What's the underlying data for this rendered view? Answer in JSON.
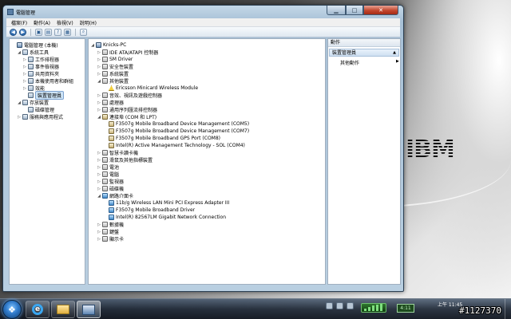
{
  "window": {
    "title": "電腦管理"
  },
  "menu": [
    "檔案(F)",
    "動作(A)",
    "檢視(V)",
    "說明(H)"
  ],
  "left_tree": [
    {
      "label": "電腦管理 (本機)",
      "level": 0,
      "exp": "",
      "icon": "comp"
    },
    {
      "label": "系統工具",
      "level": 1,
      "exp": "◢",
      "icon": "tool"
    },
    {
      "label": "工作排程器",
      "level": 2,
      "exp": "▷",
      "icon": "tool"
    },
    {
      "label": "事件檢視器",
      "level": 2,
      "exp": "▷",
      "icon": "tool"
    },
    {
      "label": "共用資料夾",
      "level": 2,
      "exp": "▷",
      "icon": "tool"
    },
    {
      "label": "本機使用者和群組",
      "level": 2,
      "exp": "▷",
      "icon": "tool"
    },
    {
      "label": "效能",
      "level": 2,
      "exp": "▷",
      "icon": "tool"
    },
    {
      "label": "裝置管理員",
      "level": 2,
      "exp": "",
      "icon": "tool",
      "selected": true
    },
    {
      "label": "存放裝置",
      "level": 1,
      "exp": "◢",
      "icon": "tool"
    },
    {
      "label": "磁碟管理",
      "level": 2,
      "exp": "",
      "icon": "tool"
    },
    {
      "label": "服務與應用程式",
      "level": 1,
      "exp": "▷",
      "icon": "tool"
    }
  ],
  "device_tree": [
    {
      "label": "Knicks-PC",
      "level": 0,
      "exp": "◢",
      "icon": "comp"
    },
    {
      "label": "IDE ATA/ATAPI 控制器",
      "level": 1,
      "exp": "▷",
      "icon": "dev"
    },
    {
      "label": "SM Driver",
      "level": 1,
      "exp": "▷",
      "icon": "dev"
    },
    {
      "label": "安全性裝置",
      "level": 1,
      "exp": "▷",
      "icon": "dev"
    },
    {
      "label": "系統裝置",
      "level": 1,
      "exp": "▷",
      "icon": "dev"
    },
    {
      "label": "其他裝置",
      "level": 1,
      "exp": "◢",
      "icon": "dev"
    },
    {
      "label": "Ericsson Minicard Wireless Module",
      "level": 2,
      "exp": "",
      "icon": "warn"
    },
    {
      "label": "音效、視訊及遊戲控制器",
      "level": 1,
      "exp": "▷",
      "icon": "dev"
    },
    {
      "label": "處理器",
      "level": 1,
      "exp": "▷",
      "icon": "dev"
    },
    {
      "label": "通用序列匯流排控制器",
      "level": 1,
      "exp": "▷",
      "icon": "dev"
    },
    {
      "label": "連接埠 (COM 和 LPT)",
      "level": 1,
      "exp": "◢",
      "icon": "port"
    },
    {
      "label": "F3507g Mobile Broadband Device Management (COM5)",
      "level": 2,
      "exp": "",
      "icon": "port"
    },
    {
      "label": "F3507g Mobile Broadband Device Management (COM7)",
      "level": 2,
      "exp": "",
      "icon": "port"
    },
    {
      "label": "F3507g Mobile Broadband GPS Port (COM8)",
      "level": 2,
      "exp": "",
      "icon": "port"
    },
    {
      "label": "Intel(R) Active Management Technology - SOL (COM4)",
      "level": 2,
      "exp": "",
      "icon": "port"
    },
    {
      "label": "智慧卡讀卡機",
      "level": 1,
      "exp": "▷",
      "icon": "dev"
    },
    {
      "label": "滑鼠及其他指標裝置",
      "level": 1,
      "exp": "▷",
      "icon": "dev"
    },
    {
      "label": "電池",
      "level": 1,
      "exp": "▷",
      "icon": "dev"
    },
    {
      "label": "電腦",
      "level": 1,
      "exp": "▷",
      "icon": "dev"
    },
    {
      "label": "監視器",
      "level": 1,
      "exp": "▷",
      "icon": "dev"
    },
    {
      "label": "磁碟機",
      "level": 1,
      "exp": "▷",
      "icon": "dev"
    },
    {
      "label": "網路介面卡",
      "level": 1,
      "exp": "◢",
      "icon": "net"
    },
    {
      "label": "11b/g Wireless LAN Mini PCI Express Adapter III",
      "level": 2,
      "exp": "",
      "icon": "net"
    },
    {
      "label": "F3507g Mobile Broadband Driver",
      "level": 2,
      "exp": "",
      "icon": "net"
    },
    {
      "label": "Intel(R) 82567LM Gigabit Network Connection",
      "level": 2,
      "exp": "",
      "icon": "net"
    },
    {
      "label": "數據機",
      "level": 1,
      "exp": "▷",
      "icon": "dev"
    },
    {
      "label": "鍵盤",
      "level": 1,
      "exp": "▷",
      "icon": "dev"
    },
    {
      "label": "顯示卡",
      "level": 1,
      "exp": "▷",
      "icon": "dev"
    }
  ],
  "actions": {
    "header": "動作",
    "section": "裝置管理員",
    "item": "其他動作"
  },
  "taskbar": {
    "clock_time": "上午 11:45",
    "battery_label": "4:11"
  },
  "desktop": {
    "logo": "IBM"
  },
  "watermark": "#1127370"
}
